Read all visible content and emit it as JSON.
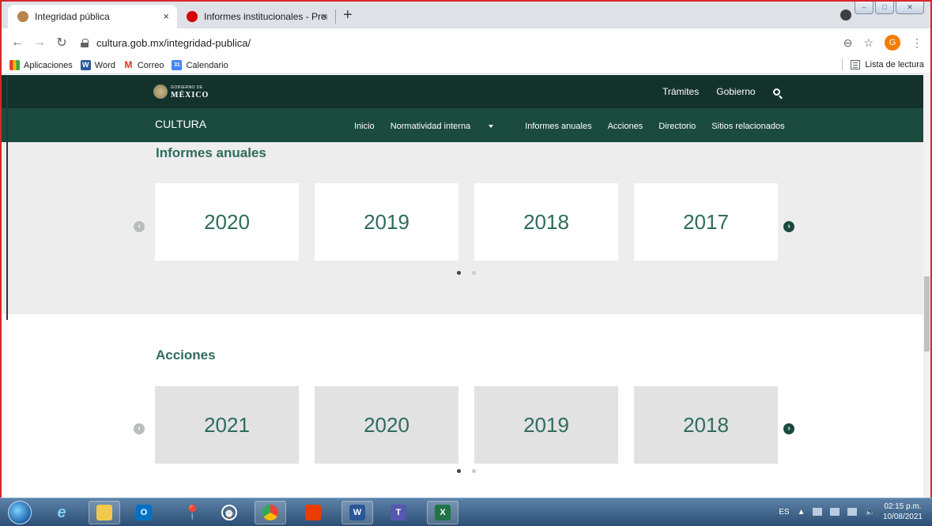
{
  "browser": {
    "tabs": [
      {
        "title": "Integridad pública",
        "favicon_color": "#b8864b"
      },
      {
        "title": "Informes institucionales - Pronun",
        "favicon_color": "#d50000"
      }
    ],
    "close_glyph": "×",
    "new_tab_glyph": "+",
    "url": "cultura.gob.mx/integridad-publica/",
    "profile_initial": "G",
    "bookmarks": [
      {
        "label": "Aplicaciones",
        "icon": "apps-grid-icon"
      },
      {
        "label": "Word",
        "icon": "word-icon"
      },
      {
        "label": "Correo",
        "icon": "gmail-icon"
      },
      {
        "label": "Calendario",
        "icon": "calendar-icon"
      }
    ],
    "reading_list": "Lista de lectura"
  },
  "site": {
    "gob_small": "GOBIERNO DE",
    "gob_big": "MÉXICO",
    "top_links": [
      "Trámites",
      "Gobierno"
    ],
    "brand": "CULTURA",
    "nav": [
      "Inicio",
      "Normatividad interna",
      "Informes anuales",
      "Acciones",
      "Directorio",
      "Sitios relacionados"
    ]
  },
  "informes": {
    "title": "Informes anuales",
    "years": [
      "2020",
      "2019",
      "2018",
      "2017"
    ]
  },
  "acciones": {
    "title": "Acciones",
    "years": [
      "2021",
      "2020",
      "2019",
      "2018"
    ]
  },
  "taskbar": {
    "lang": "ES",
    "time": "02:15 p.m.",
    "date": "10/08/2021"
  },
  "colors": {
    "gob_dark": "#13322b",
    "gob_nav": "#1b4a3e",
    "accent_text": "#2e6c5a",
    "frame_border": "#d9262b"
  }
}
